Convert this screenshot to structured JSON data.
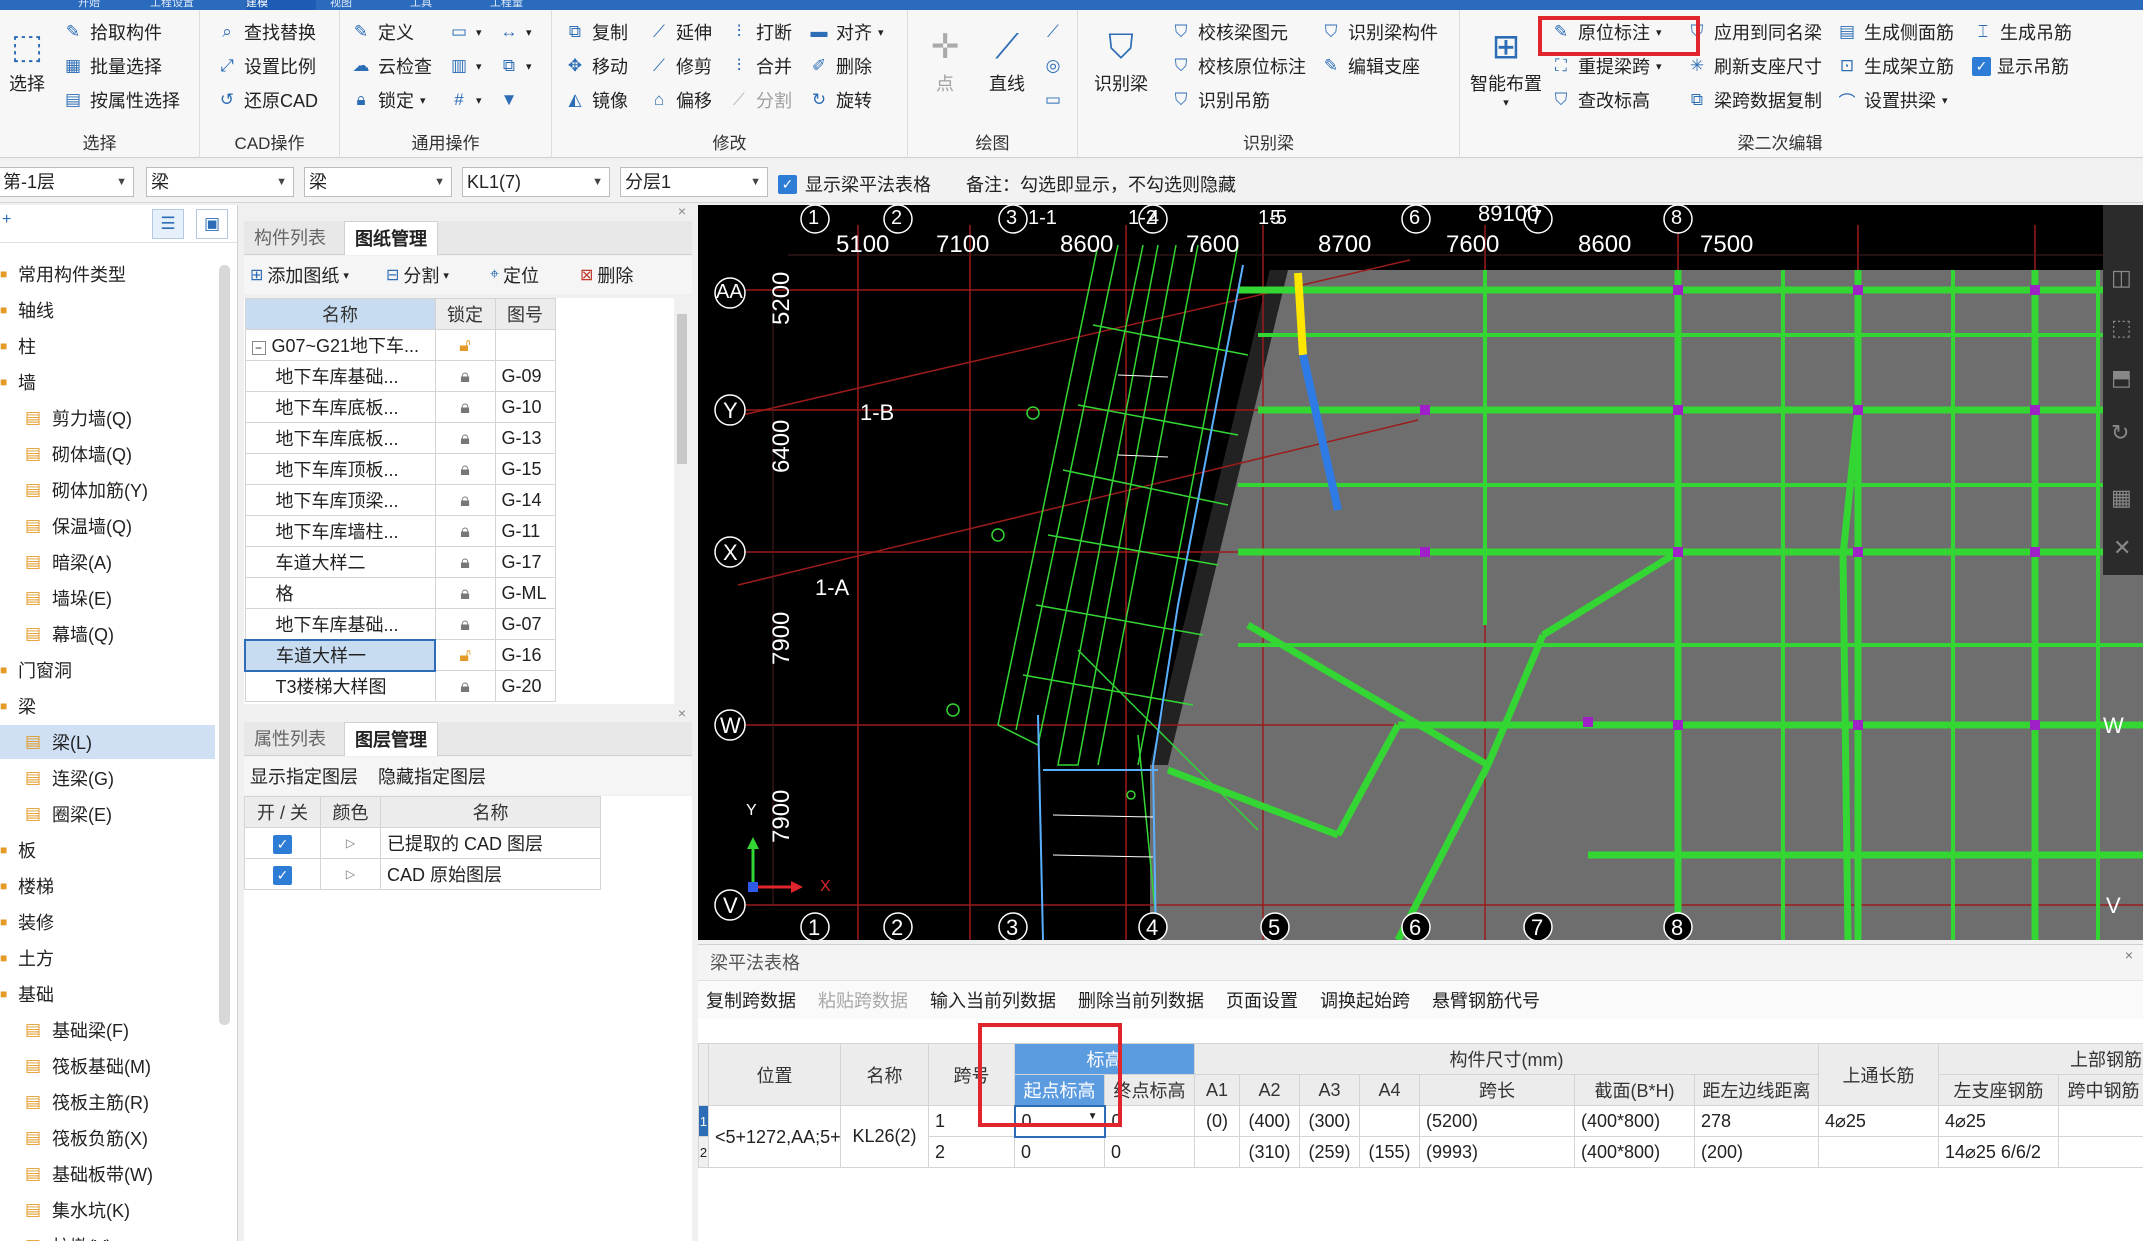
{
  "menu_tabs": [
    "开始",
    "工程设置",
    "建模",
    "视图",
    "工具",
    "工程量"
  ],
  "active_tab": "建模",
  "ribbon": {
    "select": {
      "group_label": "选择",
      "big_label": "选择",
      "items": [
        "拾取构件",
        "批量选择",
        "按属性选择"
      ]
    },
    "cad_ops": {
      "group_label": "CAD操作",
      "items": [
        "查找替换",
        "设置比例",
        "还原CAD"
      ]
    },
    "common_ops": {
      "group_label": "通用操作",
      "items": [
        "定义",
        "云检查",
        "锁定"
      ]
    },
    "modify": {
      "group_label": "修改",
      "items": [
        "复制",
        "延伸",
        "打断",
        "对齐",
        "移动",
        "修剪",
        "合并",
        "删除",
        "镜像",
        "偏移",
        "分割",
        "旋转"
      ]
    },
    "draw": {
      "group_label": "绘图",
      "items": [
        "点",
        "直线"
      ]
    },
    "recognize": {
      "group_label": "识别梁",
      "big_label": "识别梁",
      "items": [
        "校核梁图元",
        "识别梁构件",
        "校核原位标注",
        "编辑支座",
        "识别吊筋"
      ]
    },
    "beam_edit": {
      "group_label": "梁二次编辑",
      "big_label": "智能布置",
      "items": [
        "原位标注",
        "应用到同名梁",
        "生成侧面筋",
        "生成吊筋",
        "重提梁跨",
        "刷新支座尺寸",
        "生成架立筋",
        "显示吊筋",
        "查改标高",
        "梁跨数据复制",
        "设置拱梁"
      ]
    }
  },
  "filters": {
    "floor": "第-1层",
    "type1": "梁",
    "type2": "梁",
    "component": "KL1(7)",
    "layer": "分层1",
    "show_table_label": "显示梁平法表格",
    "note": "备注：勾选即显示，不勾选则隐藏"
  },
  "tree": [
    {
      "label": "常用构件类型",
      "type": "cat"
    },
    {
      "label": "轴线",
      "type": "cat"
    },
    {
      "label": "柱",
      "type": "cat"
    },
    {
      "label": "墙",
      "type": "cat"
    },
    {
      "label": "剪力墙(Q)",
      "type": "sub"
    },
    {
      "label": "砌体墙(Q)",
      "type": "sub"
    },
    {
      "label": "砌体加筋(Y)",
      "type": "sub"
    },
    {
      "label": "保温墙(Q)",
      "type": "sub"
    },
    {
      "label": "暗梁(A)",
      "type": "sub"
    },
    {
      "label": "墙垛(E)",
      "type": "sub"
    },
    {
      "label": "幕墙(Q)",
      "type": "sub"
    },
    {
      "label": "门窗洞",
      "type": "cat"
    },
    {
      "label": "梁",
      "type": "cat"
    },
    {
      "label": "梁(L)",
      "type": "sub",
      "selected": true
    },
    {
      "label": "连梁(G)",
      "type": "sub"
    },
    {
      "label": "圈梁(E)",
      "type": "sub"
    },
    {
      "label": "板",
      "type": "cat"
    },
    {
      "label": "楼梯",
      "type": "cat"
    },
    {
      "label": "装修",
      "type": "cat"
    },
    {
      "label": "土方",
      "type": "cat"
    },
    {
      "label": "基础",
      "type": "cat"
    },
    {
      "label": "基础梁(F)",
      "type": "sub"
    },
    {
      "label": "筏板基础(M)",
      "type": "sub"
    },
    {
      "label": "筏板主筋(R)",
      "type": "sub"
    },
    {
      "label": "筏板负筋(X)",
      "type": "sub"
    },
    {
      "label": "基础板带(W)",
      "type": "sub"
    },
    {
      "label": "集水坑(K)",
      "type": "sub"
    },
    {
      "label": "柱墩(V)",
      "type": "sub"
    }
  ],
  "drawings_panel": {
    "tabs": [
      "构件列表",
      "图纸管理"
    ],
    "tools": [
      "添加图纸",
      "分割",
      "定位",
      "删除"
    ],
    "columns": [
      "名称",
      "锁定",
      "图号"
    ],
    "group": "G07~G21地下车...",
    "rows": [
      {
        "name": "地下车库基础...",
        "no": "G-09"
      },
      {
        "name": "地下车库底板...",
        "no": "G-10"
      },
      {
        "name": "地下车库底板...",
        "no": "G-13"
      },
      {
        "name": "地下车库顶板...",
        "no": "G-15"
      },
      {
        "name": "地下车库顶梁...",
        "no": "G-14"
      },
      {
        "name": "地下车库墙柱...",
        "no": "G-11"
      },
      {
        "name": "车道大样二",
        "no": "G-17"
      },
      {
        "name": "格",
        "no": "G-ML"
      },
      {
        "name": "地下车库基础...",
        "no": "G-07"
      },
      {
        "name": "车道大样一",
        "no": "G-16",
        "selected": true
      },
      {
        "name": "T3楼梯大样图",
        "no": "G-20"
      }
    ]
  },
  "layers_panel": {
    "tabs": [
      "属性列表",
      "图层管理"
    ],
    "tools": [
      "显示指定图层",
      "隐藏指定图层"
    ],
    "columns": [
      "开 / 关",
      "颜色",
      "名称"
    ],
    "rows": [
      "已提取的 CAD 图层",
      "CAD 原始图层"
    ]
  },
  "cad": {
    "top_axes": [
      "1",
      "2",
      "3",
      "1-1",
      "1-2",
      "4",
      "1-5",
      "5",
      "6",
      "7",
      "8"
    ],
    "top_dims": [
      "5100",
      "7100",
      "8600",
      "7600",
      "8700",
      "7600",
      "8600",
      "7500"
    ],
    "top_dim_extra": "89100",
    "bottom_axes": [
      "1",
      "2",
      "3",
      "4",
      "5",
      "6",
      "7",
      "8"
    ],
    "left_axes": [
      "AA",
      "Y",
      "X",
      "W",
      "V"
    ],
    "left_dims": [
      "5200",
      "6400",
      "7900",
      "7900"
    ],
    "sub_axes": [
      "1-B",
      "1-A"
    ],
    "axis_x": "X",
    "axis_y": "Y",
    "colors": {
      "grid": "#9b1b1b",
      "beam": "#33d633",
      "slab": "#6e6e6e",
      "col": "#a020c8"
    }
  },
  "beam_table": {
    "title": "梁平法表格",
    "tools": [
      "复制跨数据",
      "粘贴跨数据",
      "输入当前列数据",
      "删除当前列数据",
      "页面设置",
      "调换起始跨",
      "悬臂钢筋代号"
    ],
    "disabled_tool": "粘贴跨数据",
    "headers": {
      "pos": "位置",
      "name": "名称",
      "span": "跨号",
      "elev": "标高",
      "elev_start": "起点标高",
      "elev_end": "终点标高",
      "size_group": "构件尺寸(mm)",
      "a1": "A1",
      "a2": "A2",
      "a3": "A3",
      "a4": "A4",
      "len": "跨长",
      "section": "截面(B*H)",
      "edge": "距左边线距离",
      "top_long": "上通长筋",
      "top_group": "上部钢筋",
      "left_seat": "左支座钢筋",
      "mid": "跨中钢筋"
    },
    "rows": [
      {
        "idx": "1",
        "pos": "<5+1272,AA;5+...",
        "name": "KL26(2)",
        "span": "1",
        "start": "0",
        "end": "0",
        "a1": "(0)",
        "a2": "(400)",
        "a3": "(300)",
        "a4": "",
        "len": "(5200)",
        "section": "(400*800)",
        "edge": "278",
        "top_long": "4⌀25",
        "left_seat": "4⌀25",
        "mid": ""
      },
      {
        "idx": "2",
        "pos": "",
        "name": "",
        "span": "2",
        "start": "0",
        "end": "0",
        "a1": "",
        "a2": "(310)",
        "a3": "(259)",
        "a4": "(155)",
        "len": "(9993)",
        "section": "(400*800)",
        "edge": "(200)",
        "top_long": "",
        "left_seat": "14⌀25 6/6/2",
        "mid": ""
      }
    ]
  }
}
